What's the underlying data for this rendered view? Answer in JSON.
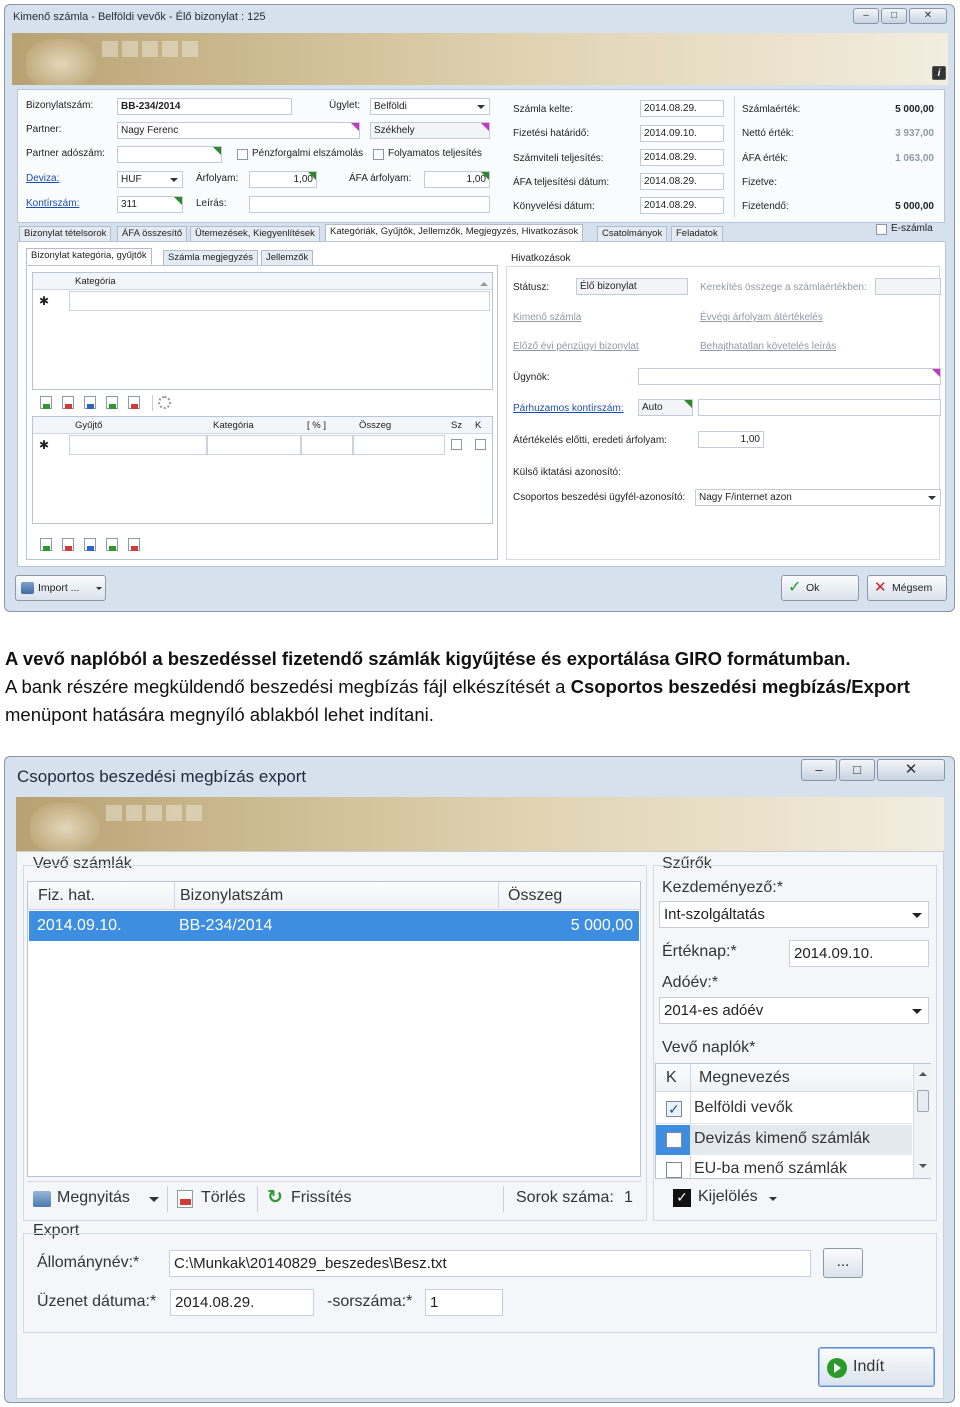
{
  "win1": {
    "title": "Kimenő számla - Belföldi vevők - Élő bizonylat : 125",
    "info_icon": "i",
    "fields": {
      "bizonylatszam_label": "Bizonylatszám:",
      "bizonylatszam": "BB-234/2014",
      "ugylet_label": "Ügylet:",
      "ugylet": "Belföldi",
      "partner_label": "Partner:",
      "partner": "Nagy Ferenc",
      "szekhely": "Székhely",
      "adoszam_label": "Partner adószám:",
      "penzforgalmi": "Pénzforgalmi elszámolás",
      "folyamatos": "Folyamatos teljesítés",
      "deviza_label": "Deviza:",
      "deviza": "HUF",
      "arfolyam_label": "Árfolyam:",
      "arfolyam": "1,00",
      "afa_arfolyam_label": "ÁFA árfolyam:",
      "afa_arfolyam": "1,00",
      "kontirszam_label": "Kontírszám:",
      "kontirszam": "311",
      "leiras_label": "Leírás:"
    },
    "dates": {
      "kelte_label": "Számla kelte:",
      "kelte": "2014.08.29.",
      "hatarido_label": "Fizetési határidő:",
      "hatarido": "2014.09.10.",
      "szamviteli_label": "Számviteli teljesítés:",
      "szamviteli": "2014.08.29.",
      "afa_telj_label": "ÁFA teljesítési dátum:",
      "afa_telj": "2014.08.29.",
      "konyvelesi_label": "Könyvelési dátum:",
      "konyvelesi": "2014.08.29."
    },
    "totals": {
      "szamlaertek_label": "Számlaérték:",
      "szamlaertek": "5 000,00",
      "netto_label": "Nettó érték:",
      "netto": "3 937,00",
      "afa_label": "ÁFA érték:",
      "afa": "1 063,00",
      "fizetve_label": "Fizetve:",
      "fizetendo_label": "Fizetendő:",
      "fizetendo": "5 000,00"
    },
    "tabs": [
      "Bizonylat tételsorok",
      "ÁFA összesítő",
      "Ütemezések, Kiegyenlítések",
      "Kategóriák, Gyűjtők, Jellemzők, Megjegyzés, Hivatkozások",
      "Csatolmányok",
      "Feladatok"
    ],
    "eszamla": "E-számla",
    "subtabs": [
      "Bizonylat kategória, gyűjtők",
      "Számla megjegyzés",
      "Jellemzők"
    ],
    "grid1_header": "Kategória",
    "grid2_headers": [
      "Gyűjtő",
      "Kategória",
      "[ % ]",
      "Összeg",
      "Sz",
      "K"
    ],
    "new_row_marker": "✱",
    "hivatkozasok": {
      "title": "Hivatkozások",
      "status_label": "Státusz:",
      "status": "Élő bizonylat",
      "kerekites": "Kerekítés összege a számlaértékben:",
      "kimeno_szamla": "Kimenő számla",
      "evvegi": "Évvégi árfolyam átértékelés",
      "elozo_evi": "Előző évi pénzügyi bizonylat",
      "behajthatatlan": "Behajthatatlan követelés leírás",
      "ugynok_label": "Ügynök:",
      "parhuzamos_label": "Párhuzamos kontírszám:",
      "parhuzamos": "Auto",
      "atertekeles_label": "Átértékelés előtti, eredeti árfolyam:",
      "atertekeles": "1,00",
      "kulso_label": "Külső iktatási azonosító:",
      "csoportos_label": "Csoportos beszedési ügyfél-azonosító:",
      "csoportos": "Nagy F/internet azon"
    },
    "buttons": {
      "import": "Import ...",
      "ok": "Ok",
      "cancel": "Mégsem"
    }
  },
  "caption": {
    "bold_line": "A vevő naplóból a beszedéssel fizetendő számlák kigyűjtése és exportálása GIRO formátumban.",
    "text_before": "A bank részére megküldendő beszedési megbízás fájl elkészítését a ",
    "bold_inline": "Csoportos beszedési megbízás/Export",
    "text_after": " menüpont hatására megnyíló ablakból lehet indítani."
  },
  "win2": {
    "title": "Csoportos beszedési megbízás export",
    "vevo_szamlak": {
      "title": "Vevő számlák",
      "headers": [
        "Fiz. hat.",
        "Bizonylatszám",
        "Összeg"
      ],
      "rows": [
        {
          "fiz_hat": "2014.09.10.",
          "bizonylatszam": "BB-234/2014",
          "osszeg": "5 000,00"
        }
      ]
    },
    "toolbar": {
      "megnyitas": "Megnyitás",
      "torles": "Törlés",
      "frissites": "Frissítés",
      "sorok_label": "Sorok száma:",
      "sorok": "1"
    },
    "szurok": {
      "title": "Szűrők",
      "kezdemenyezo_label": "Kezdeményező:*",
      "kezdemenyezo": "Int-szolgáltatás",
      "erteknap_label": "Értéknap:*",
      "erteknap": "2014.09.10.",
      "adoev_label": "Adóév:*",
      "adoev": "2014-es adóév",
      "naplok_label": "Vevő naplók*",
      "naplok_headers": [
        "K",
        "Megnevezés"
      ],
      "naplok": [
        {
          "name": "Belföldi vevők",
          "checked": true
        },
        {
          "name": "Devizás kimenő számlák",
          "checked": false
        },
        {
          "name": "EU-ba menő számlák",
          "checked": false
        }
      ],
      "kijeloles": "Kijelölés"
    },
    "export": {
      "title": "Export",
      "allomanynev_label": "Állománynév:*",
      "allomanynev": "C:\\Munkak\\20140829_beszedes\\Besz.txt",
      "browse": "...",
      "uzenet_label": "Üzenet dátuma:*",
      "uzenet": "2014.08.29.",
      "sorszam_label": "-sorszáma:*",
      "sorszam": "1"
    },
    "indit": "Indít"
  },
  "colors": {
    "selection": "#3d8ee0",
    "link": "#1a4fb0",
    "magenta_marker": "#c238c2",
    "green_marker": "#2a8a2a"
  }
}
